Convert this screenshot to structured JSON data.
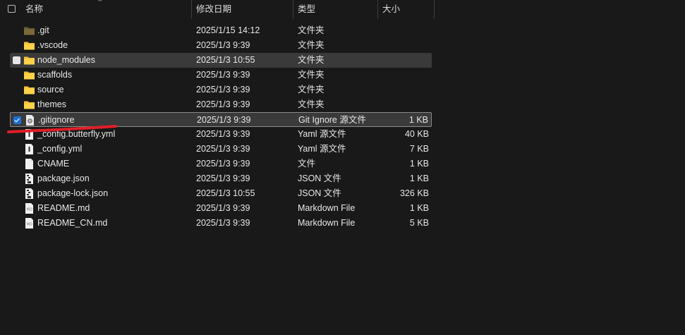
{
  "header": {
    "name": "名称",
    "date": "修改日期",
    "type": "类型",
    "size": "大小"
  },
  "files": [
    {
      "name": ".git",
      "date": "2025/1/15 14:12",
      "type": "文件夹",
      "size": "",
      "icon": "folder-dark-icon"
    },
    {
      "name": ".vscode",
      "date": "2025/1/3 9:39",
      "type": "文件夹",
      "size": "",
      "icon": "folder-icon"
    },
    {
      "name": "node_modules",
      "date": "2025/1/3 10:55",
      "type": "文件夹",
      "size": "",
      "icon": "folder-icon",
      "state": "hover"
    },
    {
      "name": "scaffolds",
      "date": "2025/1/3 9:39",
      "type": "文件夹",
      "size": "",
      "icon": "folder-icon"
    },
    {
      "name": "source",
      "date": "2025/1/3 9:39",
      "type": "文件夹",
      "size": "",
      "icon": "folder-icon"
    },
    {
      "name": "themes",
      "date": "2025/1/3 9:39",
      "type": "文件夹",
      "size": "",
      "icon": "folder-icon"
    },
    {
      "name": ".gitignore",
      "date": "2025/1/3 9:39",
      "type": "Git Ignore 源文件",
      "size": "1 KB",
      "icon": "gear-file-icon",
      "state": "selected"
    },
    {
      "name": "_config.butterfly.yml",
      "date": "2025/1/3 9:39",
      "type": "Yaml 源文件",
      "size": "40 KB",
      "icon": "yaml-file-icon"
    },
    {
      "name": "_config.yml",
      "date": "2025/1/3 9:39",
      "type": "Yaml 源文件",
      "size": "7 KB",
      "icon": "yaml-file-icon"
    },
    {
      "name": "CNAME",
      "date": "2025/1/3 9:39",
      "type": "文件",
      "size": "1 KB",
      "icon": "blank-file-icon"
    },
    {
      "name": "package.json",
      "date": "2025/1/3 9:39",
      "type": "JSON 文件",
      "size": "1 KB",
      "icon": "json-file-icon"
    },
    {
      "name": "package-lock.json",
      "date": "2025/1/3 10:55",
      "type": "JSON 文件",
      "size": "326 KB",
      "icon": "json-file-icon"
    },
    {
      "name": "README.md",
      "date": "2025/1/3 9:39",
      "type": "Markdown File",
      "size": "1 KB",
      "icon": "markdown-file-icon"
    },
    {
      "name": "README_CN.md",
      "date": "2025/1/3 9:39",
      "type": "Markdown File",
      "size": "5 KB",
      "icon": "markdown-file-icon"
    }
  ],
  "colors": {
    "background": "#191919",
    "folder": "#f4c037",
    "folder_dark": "#7a6a3a",
    "check_blue": "#1d6fd6",
    "annotation_red": "#e01e28"
  }
}
